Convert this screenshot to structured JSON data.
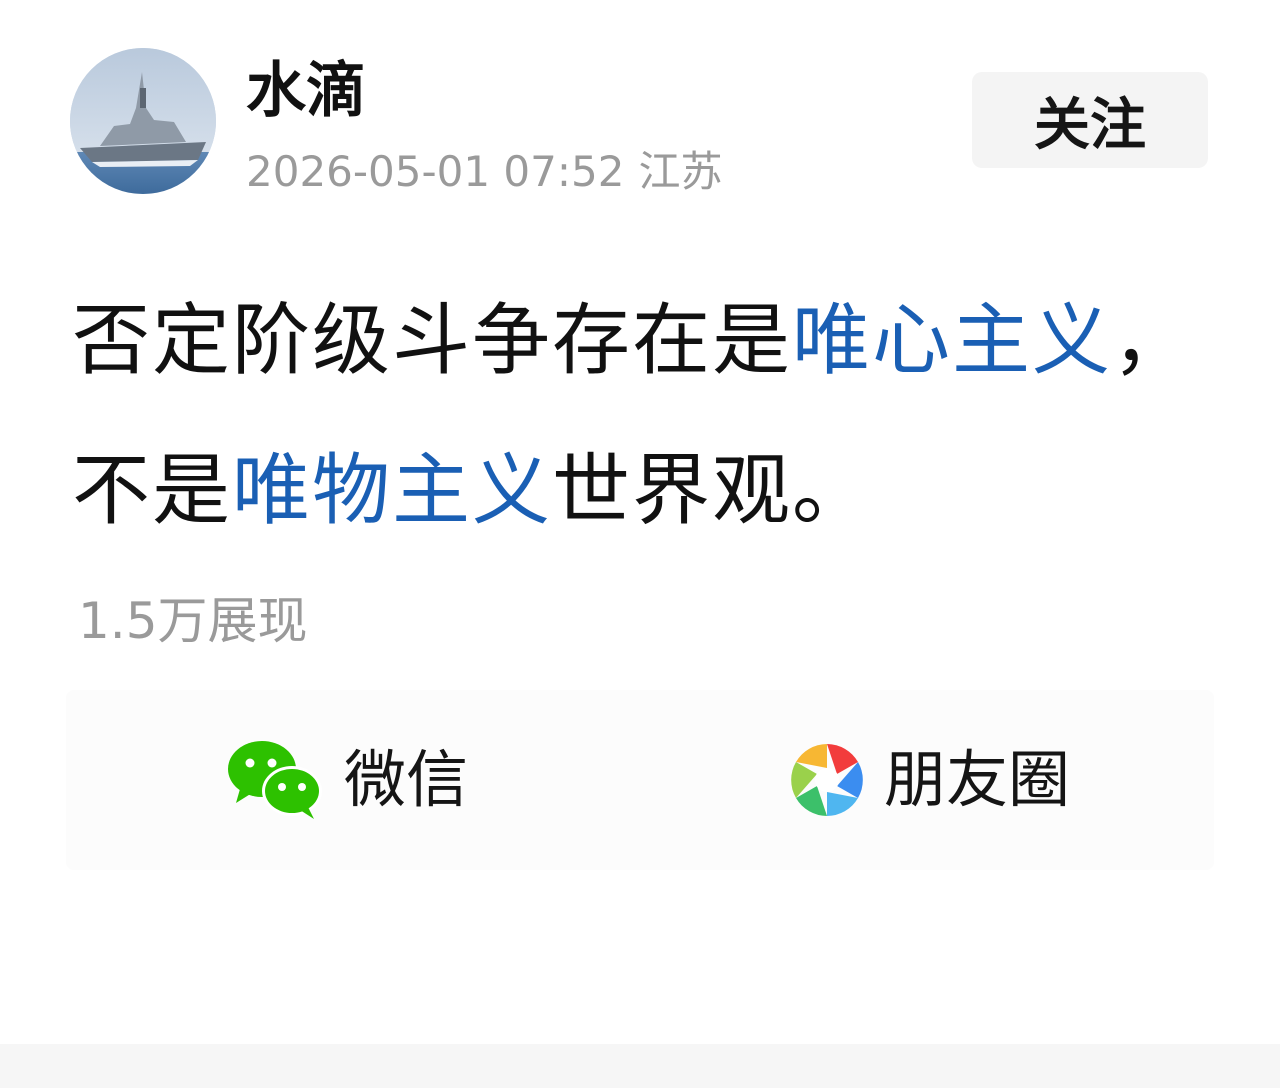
{
  "post": {
    "author": {
      "name": "水滴",
      "avatar_icon": "warship-avatar"
    },
    "date": "2026-05-01 07:52",
    "location": "江苏",
    "follow_label": "关注",
    "content_segments": [
      {
        "text": "否定阶级斗争存在是",
        "highlight": false
      },
      {
        "text": "唯心主义",
        "highlight": true
      },
      {
        "text": "，不是",
        "highlight": false
      },
      {
        "text": "唯物主义",
        "highlight": true
      },
      {
        "text": "世界观。",
        "highlight": false
      }
    ],
    "views": "1.5万展现"
  },
  "share": {
    "wechat_label": "微信",
    "wechat_icon": "wechat-icon",
    "moments_label": "朋友圈",
    "moments_icon": "moments-icon"
  },
  "colors": {
    "highlight": "#1a5fb4",
    "muted": "#9a9a9a",
    "wechat_green": "#2dc100"
  }
}
